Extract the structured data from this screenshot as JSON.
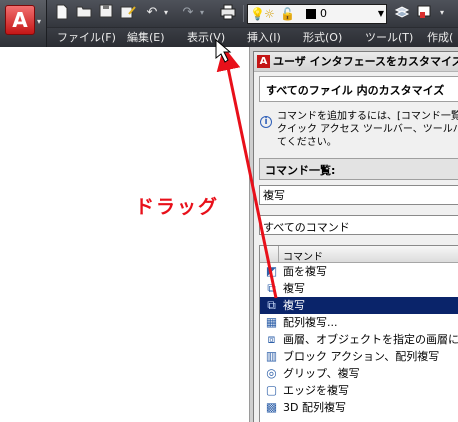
{
  "app": {
    "logo_letter": "A",
    "menu_arrow": "▾",
    "accent_color": "#c41616"
  },
  "quick_access": {
    "icons": [
      "new-file-icon",
      "open-folder-icon",
      "save-icon",
      "save-as-icon",
      "undo-icon",
      "redo-icon",
      "plot-icon"
    ],
    "layer": {
      "name": "0",
      "color": "#000000"
    }
  },
  "menu": {
    "items": [
      "ファイル(F)",
      "編集(E)",
      "表示(V)",
      "挿入(I)",
      "形式(O)",
      "ツール(T)",
      "作成("
    ]
  },
  "annotation": {
    "label": "ドラッグ",
    "color": "#e8101a"
  },
  "cui": {
    "title": "ユーザ インタフェースをカスタマイズ",
    "panel_heading": "すべてのファイル 内のカスタマイズ",
    "info_lines": [
      "コマンドを追加するには、[コマンド一覧",
      "クイック アクセス ツールバー、ツールバー",
      "てください。"
    ],
    "command_list_label": "コマンド一覧:",
    "search_value": "複写",
    "filter_value": "すべてのコマンド",
    "column_header": "コマンド",
    "commands": [
      {
        "icon": "face-copy-icon",
        "label": "面を複写",
        "selected": false
      },
      {
        "icon": "copy-icon",
        "label": "複写",
        "selected": false
      },
      {
        "icon": "copy-icon",
        "label": "複写",
        "selected": true
      },
      {
        "icon": "array-copy-icon",
        "label": "配列複写...",
        "selected": false
      },
      {
        "icon": "layer-copy-icon",
        "label": "画層、オブジェクトを指定の画層に複",
        "selected": false
      },
      {
        "icon": "block-action-icon",
        "label": "ブロック アクション、配列複写",
        "selected": false
      },
      {
        "icon": "grip-copy-icon",
        "label": "グリップ、複写",
        "selected": false
      },
      {
        "icon": "edge-copy-icon",
        "label": "エッジを複写",
        "selected": false
      },
      {
        "icon": "array-3d-icon",
        "label": "3D 配列複写",
        "selected": false
      }
    ],
    "selection_color": "#0a246a"
  }
}
